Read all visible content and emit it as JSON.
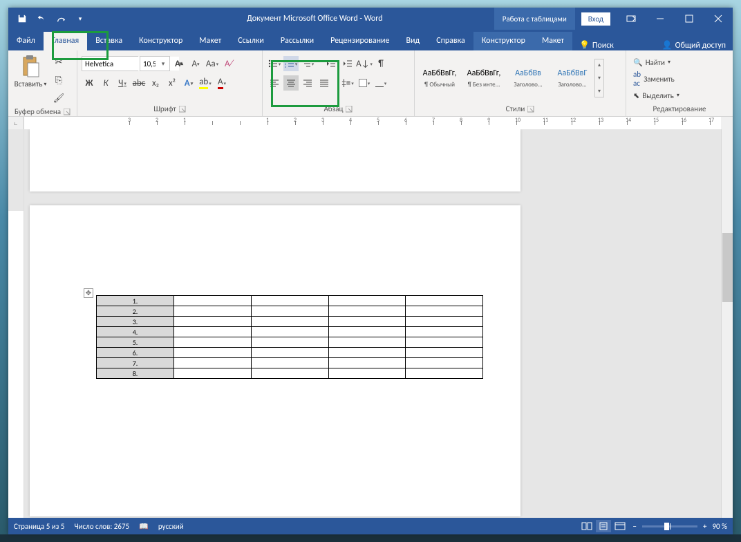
{
  "title": "Документ Microsoft Office Word  -  Word",
  "context_tab_title": "Работа с таблицами",
  "login": "Вход",
  "tabs": {
    "file": "Файл",
    "home": "Главная",
    "insert": "Вставка",
    "design": "Конструктор",
    "layout": "Макет",
    "references": "Ссылки",
    "mailings": "Рассылки",
    "review": "Рецензирование",
    "view": "Вид",
    "help": "Справка",
    "ctx_design": "Конструктор",
    "ctx_layout": "Макет",
    "tell_me": "Поиск",
    "share": "Общий доступ"
  },
  "ribbon": {
    "clipboard": {
      "label": "Буфер обмена",
      "paste": "Вставить"
    },
    "font": {
      "label": "Шрифт",
      "name": "Helvetica",
      "size": "10,5",
      "bold": "Ж",
      "italic": "К",
      "underline": "Ч",
      "strike": "abc",
      "sub": "x₂",
      "sup": "x²",
      "case": "Aa"
    },
    "paragraph": {
      "label": "Абзац"
    },
    "styles": {
      "label": "Стили",
      "items": [
        {
          "sample": "АаБбВвГг,",
          "name": "¶ Обычный",
          "color": "#000"
        },
        {
          "sample": "АаБбВвГг,",
          "name": "¶ Без инте...",
          "color": "#000"
        },
        {
          "sample": "АаБбВв",
          "name": "Заголово...",
          "color": "#2e74b5"
        },
        {
          "sample": "АаБбВвГ",
          "name": "Заголово...",
          "color": "#2e74b5"
        }
      ]
    },
    "editing": {
      "label": "Редактирование",
      "find": "Найти",
      "replace": "Заменить",
      "select": "Выделить"
    }
  },
  "table_rows": [
    "1.",
    "2.",
    "3.",
    "4.",
    "5.",
    "6.",
    "7.",
    "8."
  ],
  "status": {
    "page": "Страница 5 из 5",
    "words": "Число слов: 2675",
    "lang": "русский",
    "zoom": "90 %"
  }
}
